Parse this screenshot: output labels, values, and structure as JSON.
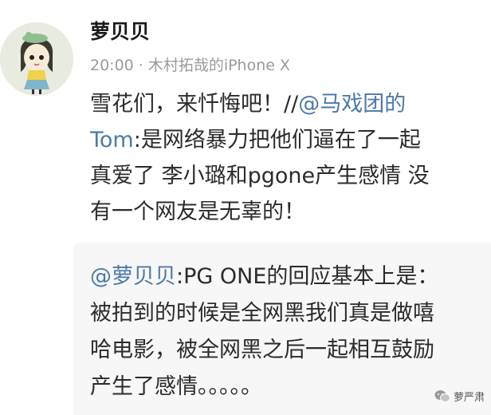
{
  "post": {
    "username": "萝贝贝",
    "time": "20:00",
    "separator": "·",
    "source": "木村拓哉的iPhone X",
    "lines": [
      {
        "before": "雪花们，来忏悔吧！//",
        "mention": "@马戏团的",
        "after": ""
      },
      {
        "before": "",
        "mention": "Tom",
        "after": ":是网络暴力把他们逼在了一起"
      },
      {
        "before": "真爱了 李小璐和pgone产生感情 没",
        "mention": "",
        "after": ""
      },
      {
        "before": "有一个网友是无辜的！",
        "mention": "",
        "after": ""
      }
    ]
  },
  "repost": {
    "lines": [
      {
        "before": "",
        "mention": "@萝贝贝",
        "after": ":PG ONE的回应基本上是："
      },
      {
        "before": "被拍到的时候是全网黑我们真是做嘻",
        "mention": "",
        "after": ""
      },
      {
        "before": "哈电影，被全网黑之后一起相互鼓励",
        "mention": "",
        "after": ""
      },
      {
        "before": "产生了感情。。。。。",
        "mention": "",
        "after": ""
      }
    ]
  },
  "watermark": {
    "text": "萝严肃",
    "icon": "wechat-icon"
  },
  "colors": {
    "mention": "#4d79a8",
    "meta": "#9a9a9a",
    "repost_bg": "#f7f7f7"
  }
}
